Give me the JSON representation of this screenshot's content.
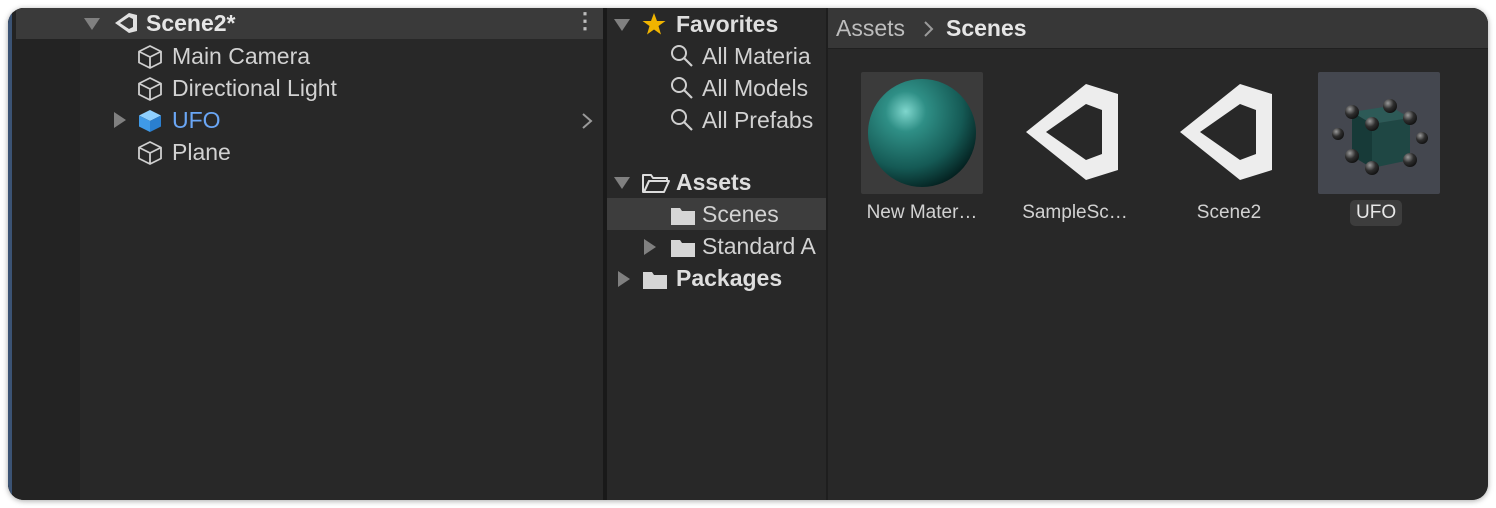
{
  "hierarchy": {
    "scene_name": "Scene2*",
    "items": [
      {
        "label": "Main Camera",
        "icon": "gameobject-cube-icon"
      },
      {
        "label": "Directional Light",
        "icon": "gameobject-cube-icon"
      },
      {
        "label": "UFO",
        "icon": "prefab-cube-icon",
        "color": "#6aa6f5"
      },
      {
        "label": "Plane",
        "icon": "gameobject-cube-icon"
      }
    ]
  },
  "project": {
    "favorites": {
      "label": "Favorites",
      "items": [
        "All Materia",
        "All Models",
        "All Prefabs"
      ]
    },
    "assets": {
      "label": "Assets",
      "items": [
        "Scenes",
        "Standard A"
      ]
    },
    "packages": "Packages"
  },
  "breadcrumb": {
    "root": "Assets",
    "current": "Scenes"
  },
  "assets_grid": [
    {
      "label": "New Mater…",
      "icon": "material-sphere-icon"
    },
    {
      "label": "SampleSc…",
      "icon": "unity-scene-icon"
    },
    {
      "label": "Scene2",
      "icon": "unity-scene-icon"
    },
    {
      "label": "UFO",
      "icon": "prefab-model-icon",
      "selected": true
    }
  ],
  "colors": {
    "panel": "#282828",
    "selected_text": "#6aa6f5",
    "star": "#f0b400"
  }
}
